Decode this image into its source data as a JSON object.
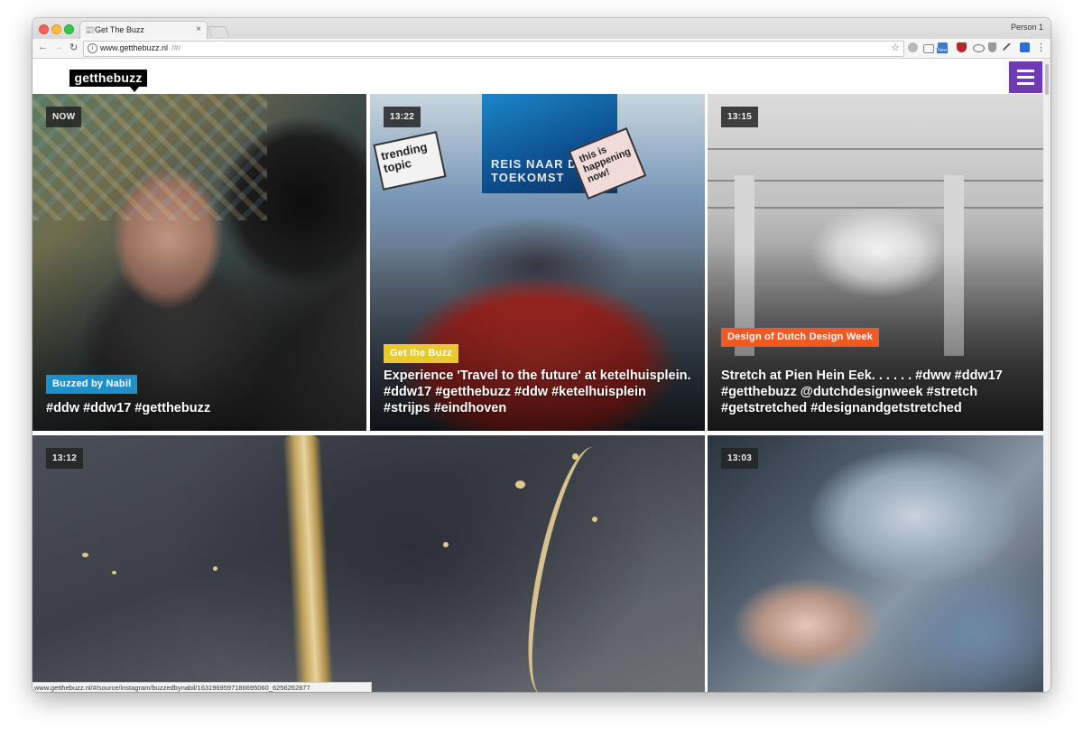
{
  "browser": {
    "tab_favicon": "📰",
    "tab_title": "Get The Buzz",
    "tab_close": "×",
    "profile": "Person 1",
    "url_host": "www.getthebuzz.nl",
    "url_path": "/#/",
    "status_url": "www.getthebuzz.nl/#/source/instagram/buzzedbynabil/1631969597186695060_6256262877",
    "icons": [
      "back-arrow-icon",
      "forward-arrow-icon",
      "reload-icon",
      "info-icon",
      "star-icon",
      "kebab-menu-icon"
    ]
  },
  "site": {
    "logo": "getthebuzz",
    "menu_icon": "hamburger-icon",
    "accent_color": "#6f3bb5"
  },
  "cards": [
    {
      "time": "NOW",
      "tag": "Buzzed by Nabil",
      "tag_color": "#1f8fc9",
      "caption": "#ddw #ddw17 #getthebuzz"
    },
    {
      "time": "13:22",
      "tag": "Get the Buzz",
      "tag_color": "#e9c92b",
      "caption": "Experience 'Travel to the future' at ketelhuisplein. #ddw17 #getthebuzz #ddw #ketelhuisplein #strijps #eindhoven",
      "sign_left": "trending topic",
      "sign_right": "this is happening now!",
      "billboard": "REIS NAAR DE TOEKOMST"
    },
    {
      "time": "13:15",
      "tag": "Design of Dutch Design Week",
      "tag_color": "#f05a22",
      "caption": "Stretch at Pien Hein Eek. . . . . . #dww #ddw17 #getthebuzz @dutchdesignweek #stretch #getstretched #designandgetstretched"
    },
    {
      "time": "13:12"
    },
    {
      "time": "13:03"
    }
  ]
}
